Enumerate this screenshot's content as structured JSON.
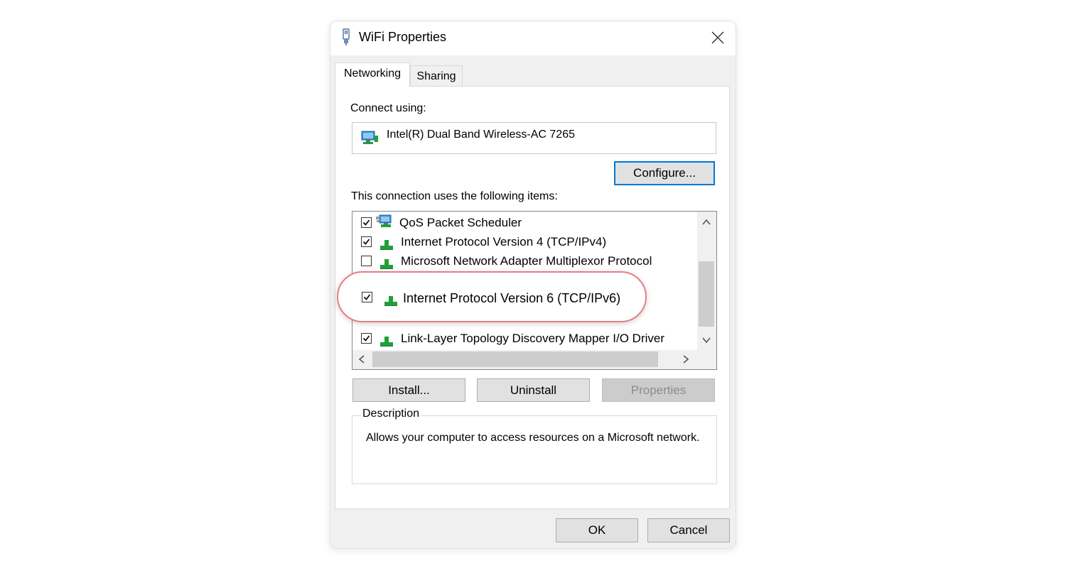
{
  "window": {
    "title": "WiFi Properties",
    "icon": "network-adapter-icon"
  },
  "tabs": [
    {
      "label": "Networking",
      "active": true
    },
    {
      "label": "Sharing",
      "active": false
    }
  ],
  "connect_using": {
    "label": "Connect using:",
    "adapter_name": "Intel(R) Dual Band Wireless-AC 7265",
    "configure_label": "Configure..."
  },
  "items_section": {
    "label": "This connection uses the following items:",
    "items": [
      {
        "label": "QoS Packet Scheduler",
        "checked": true,
        "icon": "network-service-icon"
      },
      {
        "label": "Internet Protocol Version 4 (TCP/IPv4)",
        "checked": true,
        "icon": "protocol-icon"
      },
      {
        "label": "Microsoft Network Adapter Multiplexor Protocol",
        "checked": false,
        "icon": "protocol-icon"
      },
      {
        "label": "Link-Layer Topology Discovery Mapper I/O Driver",
        "checked": true,
        "icon": "protocol-icon"
      }
    ],
    "highlighted_item": {
      "label": "Internet Protocol Version 6 (TCP/IPv6)",
      "checked": true,
      "icon": "protocol-icon"
    }
  },
  "buttons": {
    "install": "Install...",
    "uninstall": "Uninstall",
    "properties": "Properties",
    "ok": "OK",
    "cancel": "Cancel"
  },
  "description": {
    "legend": "Description",
    "text": "Allows your computer to access resources on a Microsoft network."
  },
  "colors": {
    "highlight_border": "#e77f86",
    "focus_border": "#0078d7",
    "protocol_icon": "#1fa13a"
  }
}
